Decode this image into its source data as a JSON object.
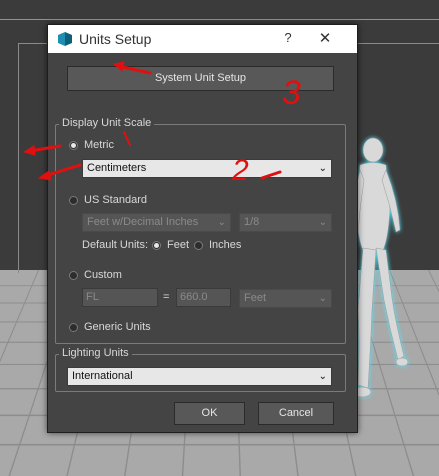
{
  "dialog": {
    "title": "Units Setup",
    "help_glyph": "?",
    "close_glyph": "✕",
    "system_unit_setup_label": "System Unit Setup",
    "ok_label": "OK",
    "cancel_label": "Cancel"
  },
  "display_unit_scale": {
    "group_label": "Display Unit Scale",
    "metric": {
      "label": "Metric",
      "selected": true,
      "dropdown_value": "Centimeters"
    },
    "us_standard": {
      "label": "US Standard",
      "selected": false,
      "unit_value": "Feet w/Decimal Inches",
      "fraction_value": "1/8",
      "default_units_label": "Default Units:",
      "feet_label": "Feet",
      "inches_label": "Inches",
      "default_unit_selected": "Feet"
    },
    "custom": {
      "label": "Custom",
      "selected": false,
      "name_value": "FL",
      "equals": "=",
      "amount_value": "660.0",
      "unit_value": "Feet"
    },
    "generic": {
      "label": "Generic Units",
      "selected": false
    }
  },
  "lighting_units": {
    "group_label": "Lighting Units",
    "value": "International"
  },
  "annotations": {
    "number_2": "2",
    "number_3": "3",
    "color": "#e01010"
  },
  "colors": {
    "accent_line": "#2fb6d8",
    "figure_glow": "#4fe8ff"
  }
}
